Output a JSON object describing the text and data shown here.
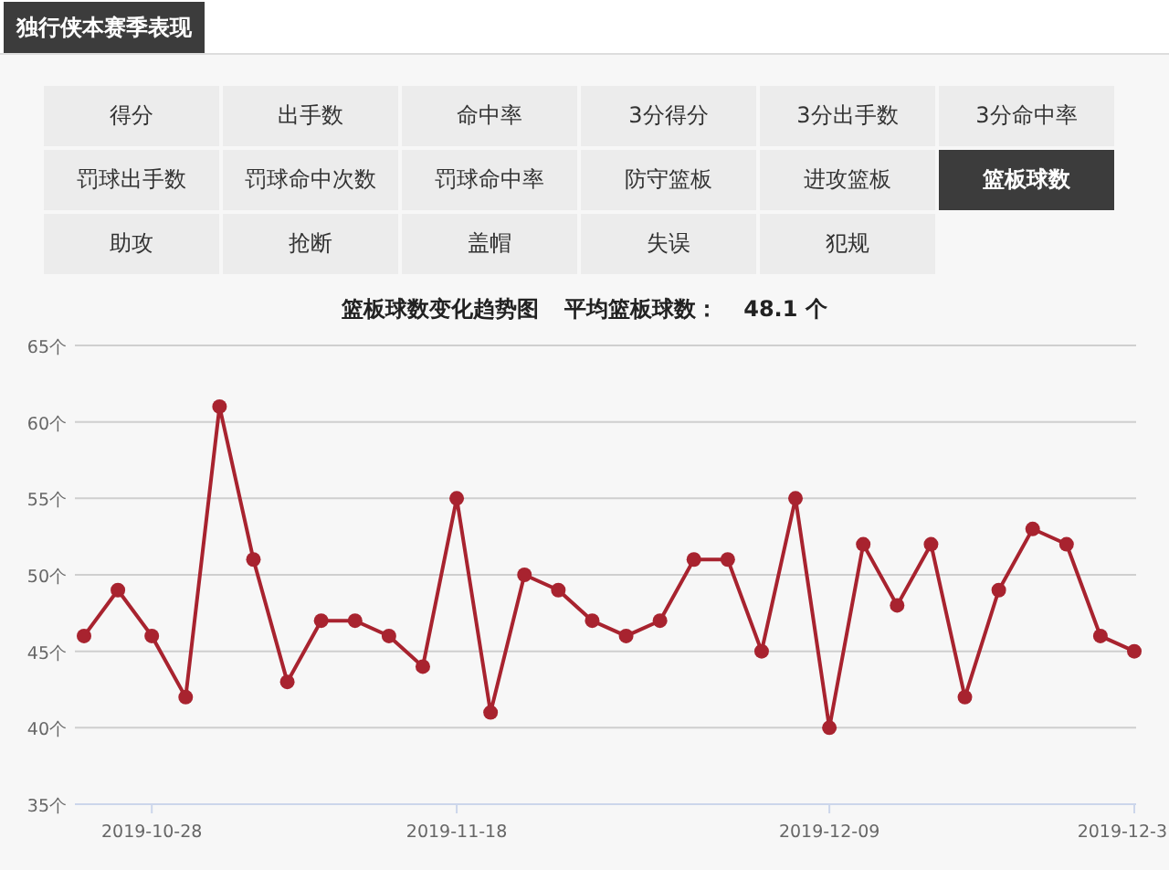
{
  "section_title": "独行侠本赛季表现",
  "stat_tabs": [
    {
      "label": "得分",
      "selected": false
    },
    {
      "label": "出手数",
      "selected": false
    },
    {
      "label": "命中率",
      "selected": false
    },
    {
      "label": "3分得分",
      "selected": false
    },
    {
      "label": "3分出手数",
      "selected": false
    },
    {
      "label": "3分命中率",
      "selected": false
    },
    {
      "label": "罚球出手数",
      "selected": false
    },
    {
      "label": "罚球命中次数",
      "selected": false
    },
    {
      "label": "罚球命中率",
      "selected": false
    },
    {
      "label": "防守篮板",
      "selected": false
    },
    {
      "label": "进攻篮板",
      "selected": false
    },
    {
      "label": "篮板球数",
      "selected": true
    },
    {
      "label": "助攻",
      "selected": false
    },
    {
      "label": "抢断",
      "selected": false
    },
    {
      "label": "盖帽",
      "selected": false
    },
    {
      "label": "失误",
      "selected": false
    },
    {
      "label": "犯规",
      "selected": false
    }
  ],
  "chart": {
    "title": "篮板球数变化趋势图",
    "average_label": "平均篮板球数：",
    "average_value": "48.1 个",
    "chart_data": {
      "type": "line",
      "categories": [
        null,
        null,
        "2019-10-28",
        null,
        null,
        null,
        null,
        null,
        null,
        null,
        null,
        "2019-11-18",
        null,
        null,
        null,
        null,
        null,
        null,
        null,
        null,
        null,
        null,
        "2019-12-09",
        null,
        null,
        null,
        null,
        null,
        null,
        null,
        null,
        "2019-12-3"
      ],
      "grid": true,
      "series": [
        {
          "marker": true,
          "color": "#a8232f",
          "values": [
            46,
            49,
            46,
            42,
            61,
            51,
            43,
            47,
            47,
            46,
            44,
            55,
            41,
            50,
            49,
            47,
            46,
            47,
            51,
            51,
            45,
            55,
            40,
            52,
            48,
            52,
            42,
            49,
            53,
            52,
            46,
            45
          ]
        }
      ],
      "ylim": [
        35,
        65
      ],
      "yticks": [
        {
          "value": 35,
          "label": "35个"
        },
        {
          "value": 40,
          "label": "40个"
        },
        {
          "value": 45,
          "label": "45个"
        },
        {
          "value": 50,
          "label": "50个"
        },
        {
          "value": 55,
          "label": "55个"
        },
        {
          "value": 60,
          "label": "60个"
        },
        {
          "value": 65,
          "label": "65个"
        }
      ]
    }
  }
}
